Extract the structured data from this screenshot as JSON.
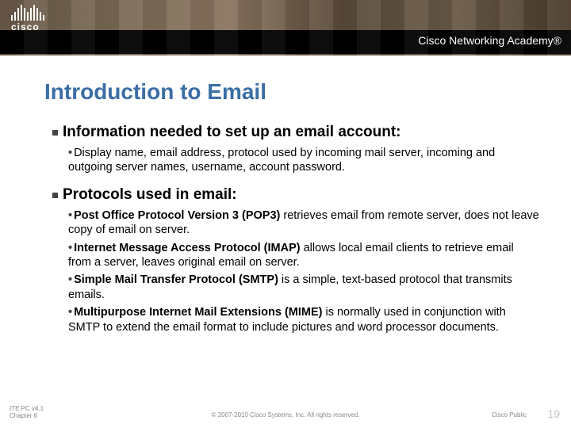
{
  "brand": {
    "name": "cisco",
    "academy": "Cisco Networking Academy®"
  },
  "title": "Introduction to Email",
  "sections": [
    {
      "heading": "Information needed to set up an email account:",
      "bullets": [
        {
          "pre": "",
          "bold": "",
          "text": "Display name, email address, protocol used by incoming mail server, incoming and outgoing server names, username, account password."
        }
      ]
    },
    {
      "heading": "Protocols used in email:",
      "bullets": [
        {
          "bold": "Post Office Protocol Version 3 (POP3)",
          "text": " retrieves email from remote server, does not leave copy of email on server."
        },
        {
          "bold": "Internet Message Access Protocol (IMAP)",
          "text": " allows local email clients to retrieve email from a server, leaves original email on server."
        },
        {
          "bold": "Simple Mail Transfer Protocol (SMTP)",
          "text": " is a simple, text-based protocol that transmits emails."
        },
        {
          "bold": "Multipurpose Internet Mail Extensions (MIME)",
          "text": " is normally used in conjunction with SMTP to extend the email format to include pictures and word processor documents."
        }
      ]
    }
  ],
  "footer": {
    "left1": "ITE PC v4.1",
    "left2": "Chapter 6",
    "center": "© 2007-2010 Cisco Systems, Inc. All rights reserved.",
    "right": "Cisco Public",
    "num": "19"
  }
}
